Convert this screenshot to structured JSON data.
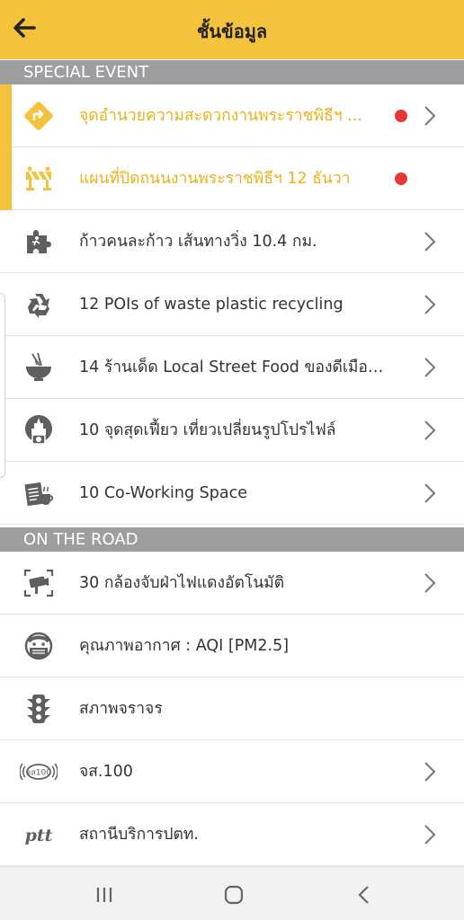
{
  "app": {
    "title": "ชั้นข้อมูล"
  },
  "sections": {
    "special_event": "SPECIAL EVENT",
    "on_the_road": "ON THE ROAD"
  },
  "special_items": [
    {
      "label": "จุดอำนวยความสะดวกงานพระราชพิธีฯ ...",
      "icon": "diamond-sign-icon",
      "highlighted": true,
      "dot": true,
      "chevron": true
    },
    {
      "label": "แผนที่ปิดถนนงานพระราชพิธีฯ 12 ธันวา",
      "icon": "road-barrier-icon",
      "highlighted": true,
      "dot": true,
      "chevron": false
    },
    {
      "label": "ก้าวคนละก้าว เส้นทางวิ่ง 10.4 กม.",
      "icon": "puzzle-runner-icon",
      "highlighted": false,
      "dot": false,
      "chevron": true
    },
    {
      "label": "12 POIs of waste plastic recycling",
      "icon": "recycle-icon",
      "highlighted": false,
      "dot": false,
      "chevron": true
    },
    {
      "label": "14 ร้านเด็ด Local Street Food ของดีเมือง...",
      "icon": "noodle-bowl-icon",
      "highlighted": false,
      "dot": false,
      "chevron": true
    },
    {
      "label": "10 จุดสุดเฟี้ยว เที่ยวเปลี่ยนรูปโปรไฟล์",
      "icon": "camera-landmark-icon",
      "highlighted": false,
      "dot": false,
      "chevron": true
    },
    {
      "label": "10 Co-Working Space",
      "icon": "coworking-icon",
      "highlighted": false,
      "dot": false,
      "chevron": true
    }
  ],
  "road_items": [
    {
      "label": "30 กล้องจับฝ่าไฟแดงอัตโนมัติ",
      "icon": "traffic-camera-icon",
      "chevron": true
    },
    {
      "label": "คุณภาพอากาศ : AQI [PM2.5]",
      "icon": "face-mask-icon",
      "chevron": false
    },
    {
      "label": "สภาพจราจร",
      "icon": "traffic-light-icon",
      "chevron": false
    },
    {
      "label": "จส.100",
      "icon": "js100-logo-icon",
      "chevron": true
    },
    {
      "label": "สถานีบริการปตท.",
      "icon": "ptt-logo-icon",
      "chevron": true
    }
  ],
  "logos": {
    "js100": "จส100",
    "ptt": "ptt"
  },
  "colors": {
    "accent": "#f5c33b",
    "highlight_text": "#e8b21c",
    "dot": "#e53935",
    "section_bg": "#9e9e9e",
    "icon": "#5f5f5f"
  }
}
